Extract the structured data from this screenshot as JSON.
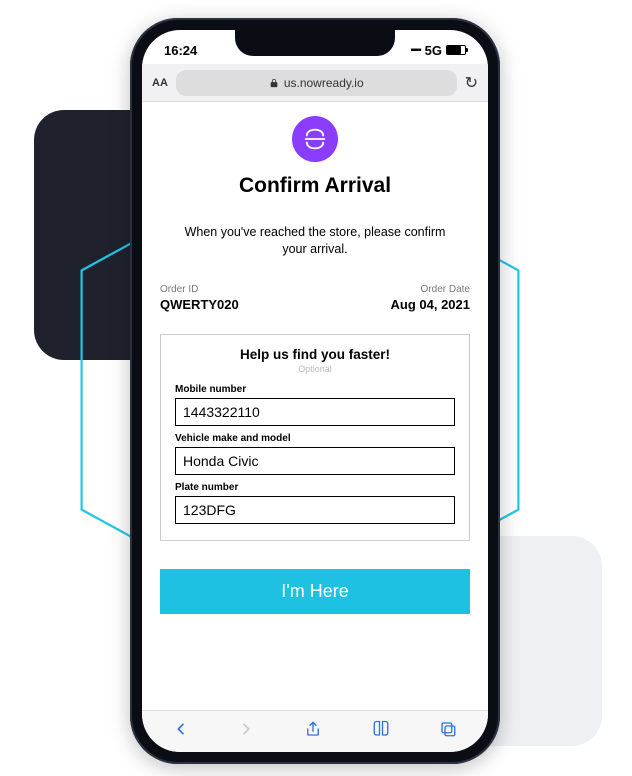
{
  "status": {
    "time": "16:24",
    "network": "5G"
  },
  "browser": {
    "aa_label": "AA",
    "url": "us.nowready.io"
  },
  "page": {
    "title": "Confirm Arrival",
    "subtitle": "When you've reached the store, please confirm your arrival."
  },
  "order": {
    "id_label": "Order ID",
    "id_value": "QWERTY020",
    "date_label": "Order Date",
    "date_value": "Aug 04, 2021"
  },
  "form": {
    "heading": "Help us find you faster!",
    "optional": "Optional",
    "mobile_label": "Mobile number",
    "mobile_value": "1443322110",
    "vehicle_label": "Vehicle make and model",
    "vehicle_value": "Honda Civic",
    "plate_label": "Plate number",
    "plate_value": "123DFG"
  },
  "cta": {
    "label": "I'm Here"
  }
}
